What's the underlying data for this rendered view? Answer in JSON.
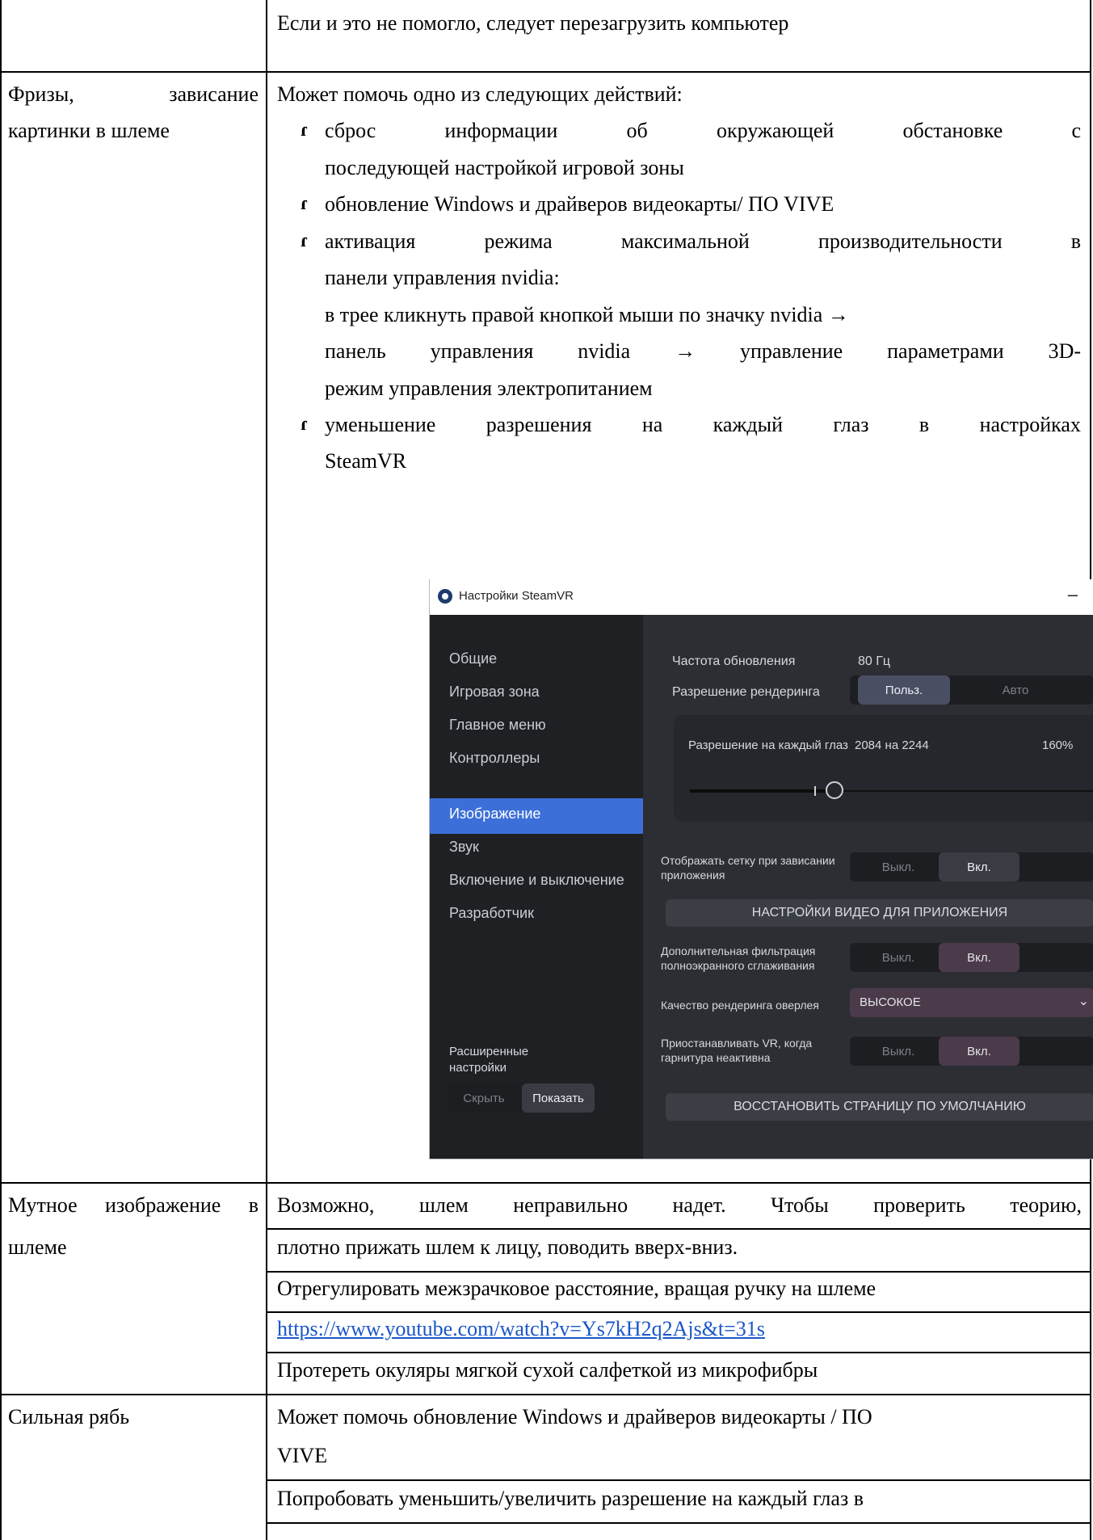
{
  "row0": {
    "right": "Если и это не помогло, следует перезагрузить компьютер"
  },
  "row1": {
    "left_line1_a": "Фризы,",
    "left_line1_b": "зависание",
    "left_line2": "картинки в шлеме",
    "intro": "Может помочь одно из следующих действий:",
    "b1_line1": [
      "сброс",
      "информации",
      "об",
      "окружающей",
      "обстановке",
      "с"
    ],
    "b1_line2": "последующей настройкой игровой зоны",
    "b2": "обновление Windows и драйверов видеокарты/ ПО VIVE",
    "b3_line1": [
      "активация",
      "режима",
      "максимальной",
      "производительности",
      "в"
    ],
    "b3_line2": "панели управления nvidia:",
    "b3_line3": "в трее кликнуть правой кнопкой мыши по значку nvidia →",
    "b3_line4": [
      "панель",
      "управления",
      "nvidia",
      "→",
      "управление",
      "параметрами",
      "3D-"
    ],
    "b3_line5": "режим управления электропитанием",
    "b4_line1": [
      "уменьшение",
      "разрешения",
      "на",
      "каждый",
      "глаз",
      "в",
      "настройках"
    ],
    "b4_line2": "SteamVR"
  },
  "steamvr": {
    "title": "Настройки SteamVR",
    "minimize": "–",
    "nav": [
      "Общие",
      "Игровая зона",
      "Главное меню",
      "Контроллеры",
      "Изображение",
      "Звук",
      "Включение и выключение",
      "Разработчик"
    ],
    "adv_label_1": "Расширенные",
    "adv_label_2": "настройки",
    "hide": "Скрыть",
    "show": "Показать",
    "refresh_label": "Частота обновления",
    "refresh_value": "80 Гц",
    "render_label": "Разрешение рендеринга",
    "custom": "Польз.",
    "auto": "Авто",
    "per_eye_label": "Разрешение на каждый глаз",
    "per_eye_value": "2084 на 2244",
    "per_eye_percent": "160%",
    "per_eye_slider_fraction": 0.34,
    "grid_label_1": "Отображать сетку при зависании",
    "grid_label_2": "приложения",
    "off": "Выкл.",
    "on": "Вкл.",
    "video_btn": "НАСТРОЙКИ ВИДЕО ДЛЯ ПРИЛОЖЕНИЯ",
    "fxaa_label_1": "Дополнительная фильтрация",
    "fxaa_label_2": "полноэкранного сглаживания",
    "overlay_label": "Качество рендеринга оверлея",
    "overlay_value": "ВЫСОКОЕ",
    "pause_label_1": "Приостанавливать VR, когда",
    "pause_label_2": "гарнитура неактивна",
    "restore_btn": "ВОССТАНОВИТЬ СТРАНИЦУ ПО УМОЛЧАНИЮ"
  },
  "row2": {
    "left_line1": [
      "Мутное",
      "изображение",
      "в"
    ],
    "left_line2": "шлеме",
    "line1": [
      "Возможно,",
      "шлем",
      "неправильно",
      "надет.",
      "Чтобы",
      "проверить",
      "теорию,"
    ],
    "line2": "плотно прижать шлем к лицу, поводить вверх-вниз.",
    "line3": "Отрегулировать межзрачковое расстояние, вращая ручку на шлеме",
    "link": "https://www.youtube.com/watch?v=Ys7kH2q2Ajs&t=31s",
    "line5": "Протереть окуляры мягкой сухой салфеткой из микрофибры"
  },
  "row3": {
    "left": "Сильная рябь",
    "line1": "Может помочь обновление Windows и драйверов видеокарты / ПО",
    "line2": "VIVE",
    "line3": "Попробовать уменьшить/увеличить разрешение на каждый глаз в"
  }
}
